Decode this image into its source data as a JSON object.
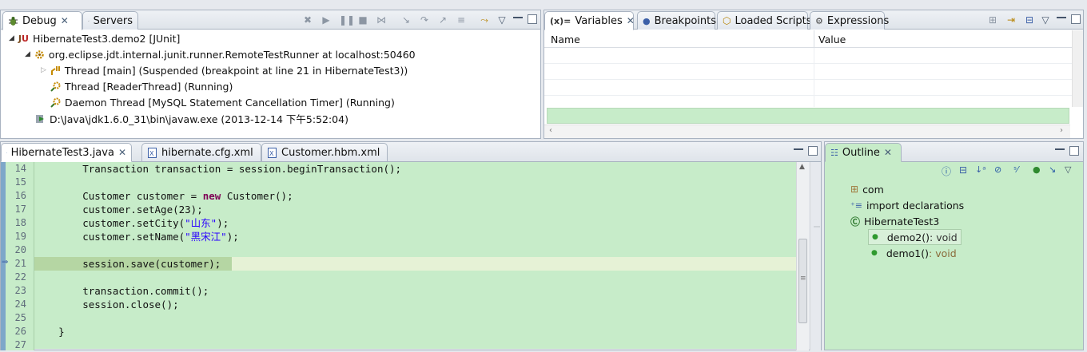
{
  "debug_view": {
    "tabs": [
      {
        "label": "Debug"
      },
      {
        "label": "Servers"
      }
    ],
    "tree": [
      {
        "label": "HibernateTest3.demo2 [JUnit]"
      },
      {
        "label": "org.eclipse.jdt.internal.junit.runner.RemoteTestRunner at localhost:50460"
      },
      {
        "label": "Thread [main] (Suspended (breakpoint at line 21 in HibernateTest3))"
      },
      {
        "label": "Thread [ReaderThread] (Running)"
      },
      {
        "label": "Daemon Thread [MySQL Statement Cancellation Timer] (Running)"
      },
      {
        "label": "D:\\Java\\jdk1.6.0_31\\bin\\javaw.exe (2013-12-14 下午5:52:04)"
      }
    ]
  },
  "variables_view": {
    "tabs": [
      {
        "label": "Variables"
      },
      {
        "label": "Breakpoints"
      },
      {
        "label": "Loaded Scripts"
      },
      {
        "label": "Expressions"
      }
    ],
    "columns": {
      "name": "Name",
      "value": "Value"
    }
  },
  "editor": {
    "tabs": [
      {
        "label": "HibernateTest3.java"
      },
      {
        "label": "hibernate.cfg.xml"
      },
      {
        "label": "Customer.hbm.xml"
      }
    ],
    "line_numbers": [
      "14",
      "15",
      "16",
      "17",
      "18",
      "19",
      "20",
      "21",
      "22",
      "23",
      "24",
      "25",
      "26",
      "27"
    ],
    "lines": {
      "l14": "        Transaction transaction = session.beginTransaction();",
      "l16a": "        Customer customer = ",
      "l16kw": "new",
      "l16b": " Customer();",
      "l17": "        customer.setAge(23);",
      "l18a": "        customer.setCity(",
      "l18s": "\"山东\"",
      "l18b": ");",
      "l19a": "        customer.setName(",
      "l19s": "\"黑宋江\"",
      "l19b": ");",
      "l21": "        session.save(customer);",
      "l23": "        transaction.commit();",
      "l24": "        session.close();",
      "l26": "    }"
    }
  },
  "outline_view": {
    "tab": "Outline",
    "items": [
      {
        "label": "com"
      },
      {
        "label": "import declarations"
      },
      {
        "label": "HibernateTest3"
      },
      {
        "label": "demo2()",
        "type": " : void"
      },
      {
        "label": "demo1()",
        "type": " : void"
      }
    ]
  },
  "colors": {
    "editor_bg": "#c7ecc9",
    "current_line": "#b5d6a3",
    "keyword": "#7f0055",
    "string": "#2a00ff"
  }
}
